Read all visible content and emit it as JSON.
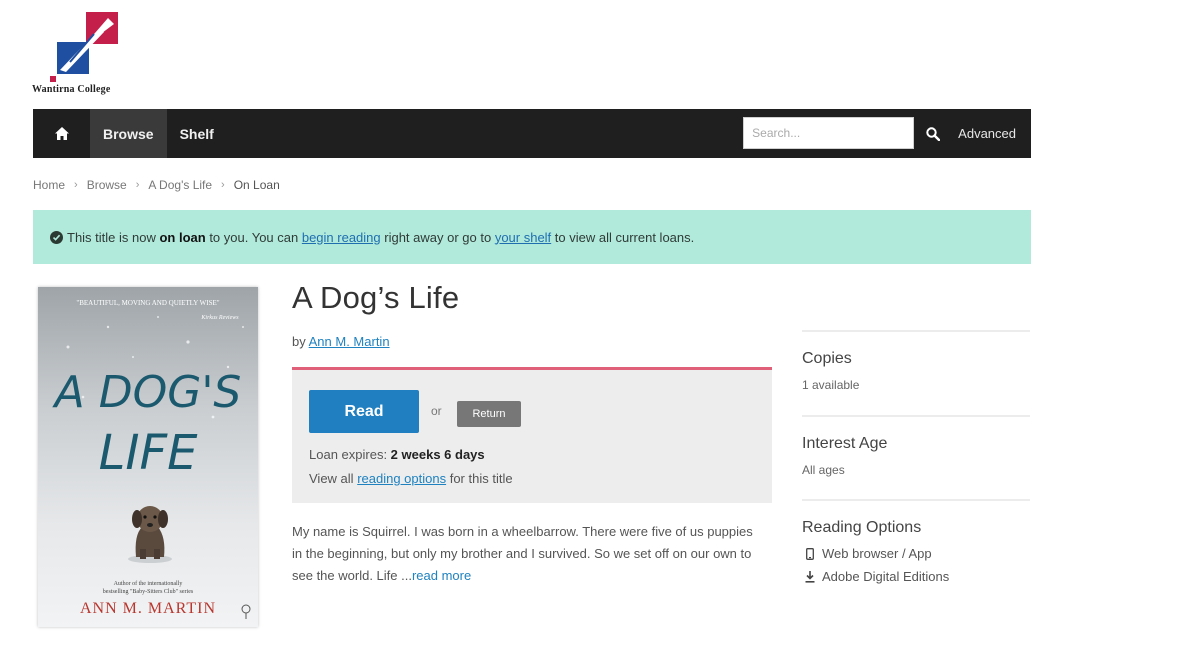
{
  "logo": {
    "name": "Wantirna College"
  },
  "nav": {
    "browse_label": "Browse",
    "shelf_label": "Shelf",
    "search_placeholder": "Search...",
    "advanced_label": "Advanced"
  },
  "breadcrumb": [
    "Home",
    "Browse",
    "A Dog's Life",
    "On Loan"
  ],
  "alert": {
    "part1": "This title is now ",
    "bold": "on loan",
    "part2": " to you. You can ",
    "link1": "begin reading",
    "part3": " right away or go to ",
    "link2": "your shelf",
    "part4": " to view all current loans."
  },
  "cover": {
    "quote": "\"BEAUTIFUL, MOVING AND QUIETLY WISE\"",
    "quote_source": "Kirkus Reviews",
    "title_line1": "A DOG'S",
    "title_line2": "LIFE",
    "author_blurb_line1": "Author of the internationally",
    "author_blurb_line2": "bestselling \"Baby-Sitters Club\" series",
    "author": "ANN M. MARTIN"
  },
  "book": {
    "title": "A Dog’s Life",
    "by_label": "by",
    "author": "Ann M. Martin"
  },
  "loan": {
    "read_label": "Read",
    "or_label": "or",
    "return_label": "Return",
    "expires_label": "Loan expires: ",
    "expires_value": "2 weeks 6 days",
    "view_all_prefix": "View all ",
    "view_all_link": "reading options",
    "view_all_suffix": " for this title"
  },
  "description": {
    "text": "My name is Squirrel. I was born in a wheelbarrow. There were five of us puppies in the beginning, but only my brother and I survived. So we set off on our own to see the world. Life ...",
    "read_more": "read more"
  },
  "sidebar": {
    "copies_heading": "Copies",
    "copies_value": "1 available",
    "interest_heading": "Interest Age",
    "interest_value": "All ages",
    "reading_heading": "Reading Options",
    "options": [
      {
        "label": "Web browser / App",
        "icon": "mobile-icon"
      },
      {
        "label": "Adobe Digital Editions",
        "icon": "download-icon"
      }
    ]
  },
  "colors": {
    "nav_bg": "#1f1f1f",
    "alert_bg": "#b1eadb",
    "read_button": "#1f7fc0",
    "panel_accent": "#e0607a",
    "logo_red": "#c41e4a",
    "logo_blue": "#1f4fa0"
  }
}
